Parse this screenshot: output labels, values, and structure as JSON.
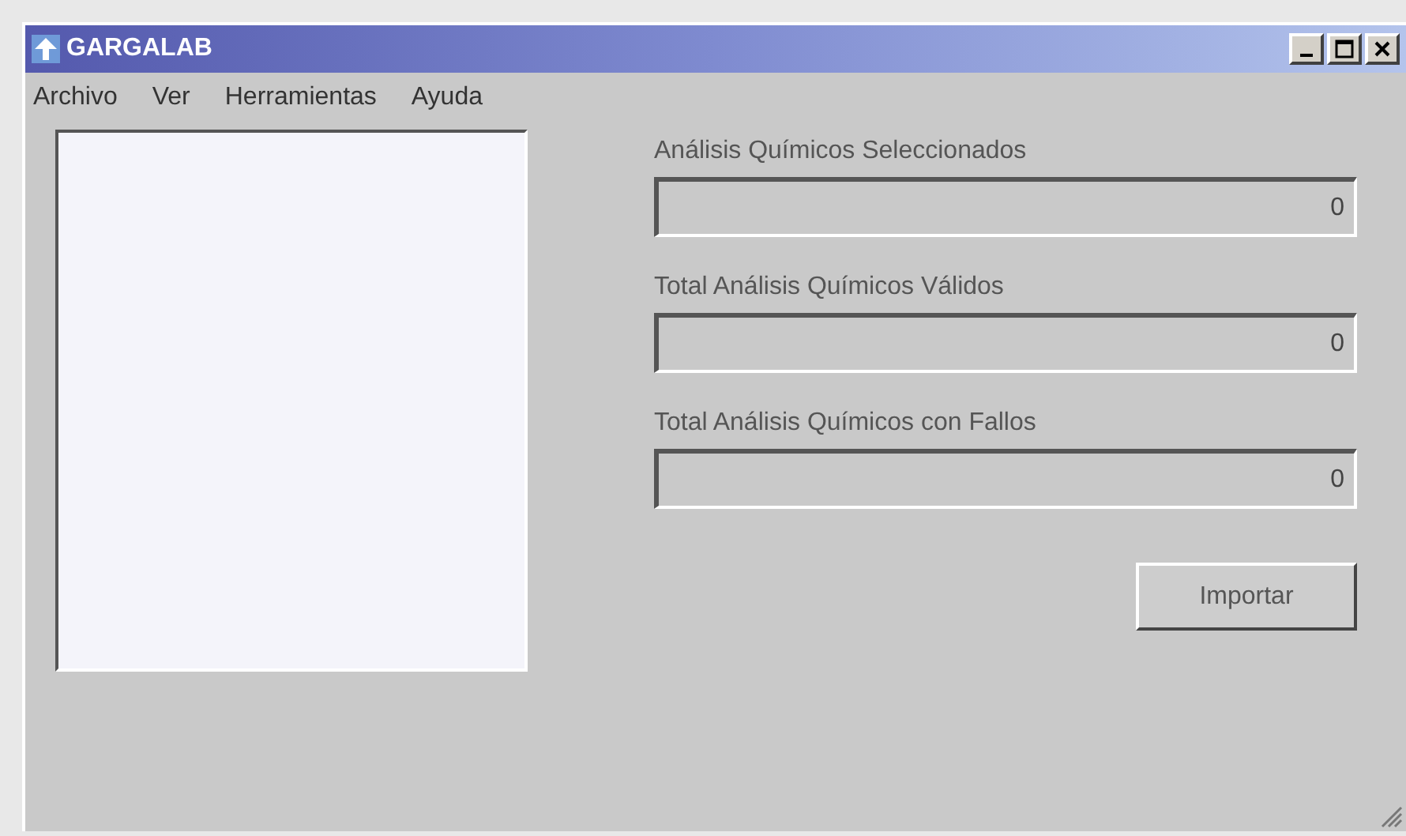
{
  "window": {
    "title": "GARGALAB"
  },
  "menu": [
    "Archivo",
    "Ver",
    "Herramientas",
    "Ayuda"
  ],
  "fields": [
    {
      "label": "Análisis Químicos Seleccionados",
      "value": "0"
    },
    {
      "label": "Total Análisis Químicos Válidos",
      "value": "0"
    },
    {
      "label": "Total Análisis Químicos con Fallos",
      "value": "0"
    }
  ],
  "buttons": [
    "Importar"
  ]
}
